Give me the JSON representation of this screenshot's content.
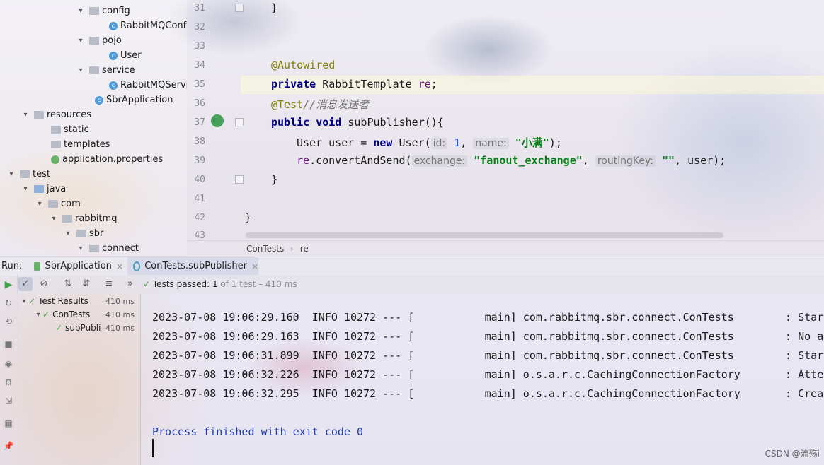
{
  "project_tree": [
    {
      "label": "config",
      "type": "folder",
      "expanded": true,
      "indent": 5
    },
    {
      "label": "RabbitMQConfig",
      "type": "class",
      "indent": 7
    },
    {
      "label": "pojo",
      "type": "folder",
      "expanded": true,
      "indent": 5
    },
    {
      "label": "User",
      "type": "class",
      "indent": 7
    },
    {
      "label": "service",
      "type": "folder",
      "expanded": true,
      "indent": 5
    },
    {
      "label": "RabbitMQServic",
      "type": "class",
      "indent": 7
    },
    {
      "label": "SbrApplication",
      "type": "class",
      "indent": 6
    },
    {
      "label": "resources",
      "type": "folder",
      "expanded": true,
      "indent": 2
    },
    {
      "label": "static",
      "type": "folder",
      "indent": 3
    },
    {
      "label": "templates",
      "type": "folder",
      "indent": 3
    },
    {
      "label": "application.properties",
      "type": "properties",
      "indent": 3
    },
    {
      "label": "test",
      "type": "folder",
      "expanded": true,
      "indent": 1
    },
    {
      "label": "java",
      "type": "source",
      "expanded": true,
      "indent": 2
    },
    {
      "label": "com",
      "type": "folder",
      "expanded": true,
      "indent": 3
    },
    {
      "label": "rabbitmq",
      "type": "folder",
      "expanded": true,
      "indent": 4
    },
    {
      "label": "sbr",
      "type": "folder",
      "expanded": true,
      "indent": 5
    },
    {
      "label": "connect",
      "type": "folder",
      "expanded": true,
      "indent": 6
    }
  ],
  "editor": {
    "line_numbers": [
      "31",
      "32",
      "33",
      "34",
      "35",
      "36",
      "37",
      "38",
      "39",
      "40",
      "41",
      "42",
      "43"
    ],
    "lines": {
      "l31": "}",
      "l34": "@Autowired",
      "l35_kw": "private",
      "l35_rest": " RabbitTemplate ",
      "l35_field": "re",
      "l35_end": ";",
      "l36_ann": "@Test",
      "l36_cmt": "//消息发送者",
      "l37_kw1": "public",
      "l37_kw2": "void",
      "l37_rest": " subPublisher(){",
      "l38_a": "User user = ",
      "l38_new": "new",
      "l38_b": " User(",
      "l38_hint1": "id:",
      "l38_num": "1",
      "l38_comma": ", ",
      "l38_hint2": "name:",
      "l38_str": "\"小满\"",
      "l38_end": ");",
      "l39_field": "re",
      "l39_call": ".convertAndSend(",
      "l39_hint1": "exchange:",
      "l39_str1": "\"fanout_exchange\"",
      "l39_comma": ", ",
      "l39_hint2": "routingKey:",
      "l39_str2": "\"\"",
      "l39_end": ", user);",
      "l40": "}",
      "l42": "}"
    }
  },
  "breadcrumb": {
    "class": "ConTests",
    "sep": "›",
    "member": "re"
  },
  "run_bar": {
    "label": "Run:",
    "tabs": [
      {
        "label": "SbrApplication",
        "active": false
      },
      {
        "label": "ConTests.subPublisher",
        "active": true
      }
    ]
  },
  "test_toolbar": {
    "status_prefix": "Tests passed:",
    "passed": "1",
    "status_suffix": "of 1 test – 410 ms"
  },
  "test_tree": [
    {
      "label": "Test Results",
      "time": "410 ms",
      "indent": 0
    },
    {
      "label": "ConTests",
      "time": "410 ms",
      "indent": 1
    },
    {
      "label": "subPubli",
      "time": "410 ms",
      "indent": 2
    }
  ],
  "console": {
    "lines": [
      "2023-07-08 19:06:29.160  INFO 10272 --- [           main] com.rabbitmq.sbr.connect.ConTests        : Start",
      "2023-07-08 19:06:29.163  INFO 10272 --- [           main] com.rabbitmq.sbr.connect.ConTests        : No ac",
      "2023-07-08 19:06:31.899  INFO 10272 --- [           main] com.rabbitmq.sbr.connect.ConTests        : Start",
      "2023-07-08 19:06:32.226  INFO 10272 --- [           main] o.s.a.r.c.CachingConnectionFactory       : Atten",
      "2023-07-08 19:06:32.295  INFO 10272 --- [           main] o.s.a.r.c.CachingConnectionFactory       : Creat"
    ],
    "exit_message": "Process finished with exit code 0"
  },
  "watermark": "CSDN @流殇i",
  "colors": {
    "keyword": "#000080",
    "annotation": "#808000",
    "string": "#067d17",
    "pass": "#4aa04a"
  }
}
